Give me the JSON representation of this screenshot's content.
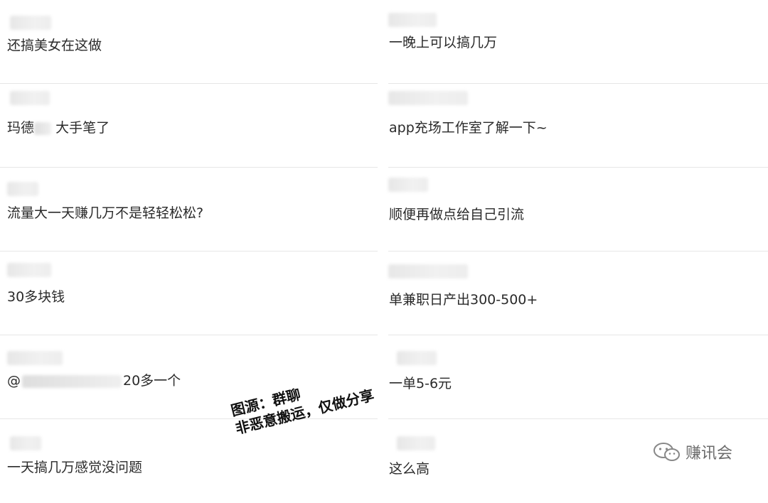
{
  "comments": {
    "left": [
      {
        "text": "还搞美女在这做"
      },
      {
        "text_a": "玛德",
        "text_b": "大手笔了"
      },
      {
        "text": "流量大一天赚几万不是轻轻松松?"
      },
      {
        "text": "30多块钱"
      },
      {
        "prefix": "@",
        "text": "20多一个"
      },
      {
        "text": "一天搞几万感觉没问题"
      }
    ],
    "right": [
      {
        "text": "一晚上可以搞几万"
      },
      {
        "text": "app充场工作室了解一下~"
      },
      {
        "text": "顺便再做点给自己引流"
      },
      {
        "text": "单兼职日产出300-500+"
      },
      {
        "text": "一单5-6元"
      },
      {
        "text": "这么高"
      }
    ]
  },
  "watermark": {
    "line1": "图源：群聊",
    "line2": "非恶意搬运，仅做分享"
  },
  "brand": {
    "icon": "wechat-icon",
    "name": "赚讯会"
  }
}
